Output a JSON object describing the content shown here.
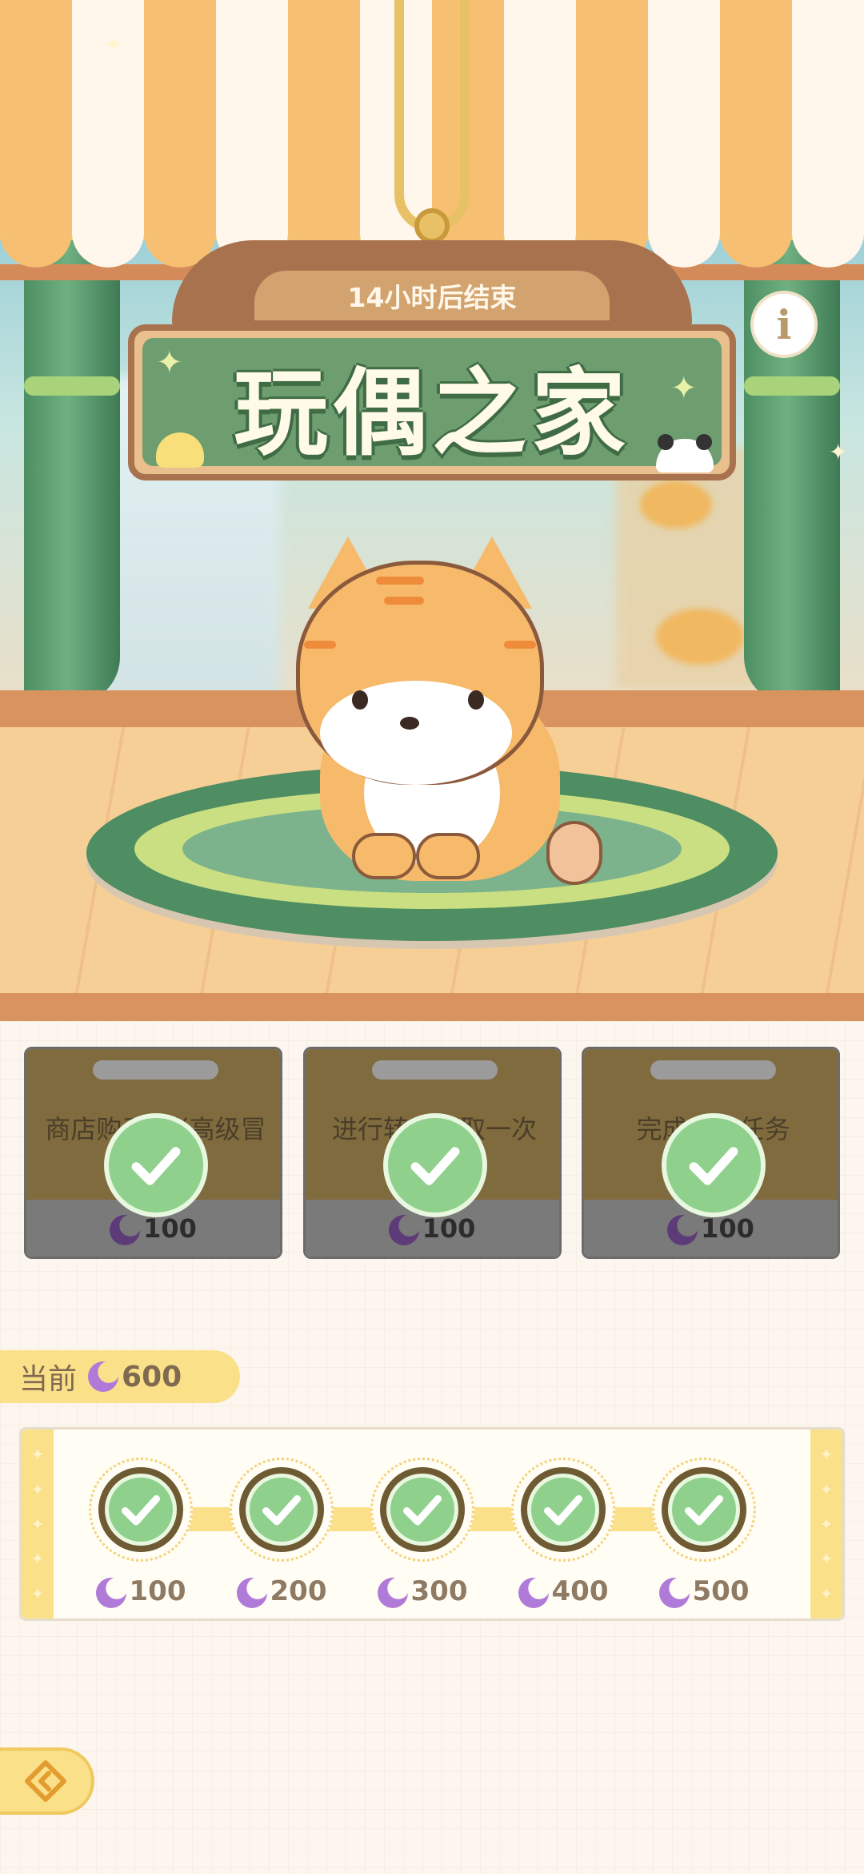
{
  "banner": {
    "timer": "14小时后结束",
    "title": "玩偶之家"
  },
  "tasks": [
    {
      "text": "商店购买1张高级冒险券",
      "reward": "100",
      "completed": true
    },
    {
      "text": "进行转盘领取一次",
      "reward": "100",
      "completed": true
    },
    {
      "text": "完成每日任务",
      "reward": "100",
      "completed": true
    }
  ],
  "current": {
    "label": "当前",
    "value": "600"
  },
  "milestones": [
    {
      "value": "100",
      "claimed": true
    },
    {
      "value": "200",
      "claimed": true
    },
    {
      "value": "300",
      "claimed": true
    },
    {
      "value": "400",
      "claimed": true
    },
    {
      "value": "500",
      "claimed": true
    }
  ],
  "icons": {
    "info": "info-icon",
    "back": "back-arrow-icon",
    "currency": "moon-icon",
    "check": "check-icon"
  },
  "colors": {
    "accent": "#fbe08a",
    "check": "#8fd08c",
    "sign_green": "#6e9d6f"
  }
}
